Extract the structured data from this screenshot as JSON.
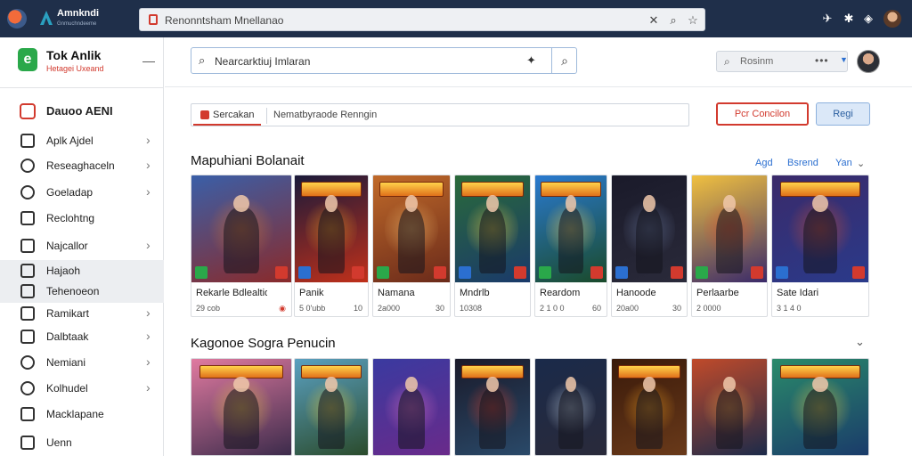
{
  "browser": {
    "app_title": "Amnkndi",
    "app_sub": "Gnmuchndeeme",
    "url": "Renonntsham Mnellanao",
    "icons": [
      "lock-icon",
      "close-icon",
      "search-icon",
      "star-icon",
      "pin-icon",
      "settings-icon",
      "location-icon"
    ]
  },
  "sidebar": {
    "brand_name": "Tok Anlik",
    "brand_sub": "Hetagei Uxeand",
    "menu_icon": "menu-icon",
    "head_label": "Dauoo AENI",
    "items": [
      {
        "label": "Aplk Ajdel",
        "icon": "square-icon",
        "chev": true
      },
      {
        "label": "Reseaghaceln",
        "icon": "smile-icon",
        "chev": true
      },
      {
        "label": "Goeladap",
        "icon": "circle-icon",
        "chev": true
      },
      {
        "label": "Reclohtng",
        "icon": "person-icon",
        "chev": false
      },
      {
        "label": "Najcallor",
        "icon": "square-icon",
        "chev": true
      },
      {
        "label": "Hajaoh",
        "icon": "square-icon",
        "chev": false
      },
      {
        "label": "Tehenoeon",
        "icon": "card-icon",
        "chev": false
      },
      {
        "label": "Ramikart",
        "icon": "search-icon",
        "chev": true
      },
      {
        "label": "Dalbtaak",
        "icon": "square-icon",
        "chev": true
      },
      {
        "label": "Nemiani",
        "icon": "search-circle-icon",
        "chev": true
      },
      {
        "label": "Kolhudel",
        "icon": "circle-icon",
        "chev": true
      },
      {
        "label": "Macklapane",
        "icon": "square-icon",
        "chev": false
      },
      {
        "label": "Uenn",
        "icon": "square-icon",
        "chev": false
      }
    ]
  },
  "search": {
    "value": "Nearcarktiuj Imlaran",
    "right_value": "Rosinm"
  },
  "filter": {
    "tab_label": "Sercakan",
    "text": "Nematbyraode Renngin"
  },
  "buttons": {
    "primary_outline": "Pcr Concilon",
    "secondary": "Regi"
  },
  "section1": {
    "title": "Mapuhiani Bolanait",
    "links": [
      "Agd",
      "Bsrend",
      "Yan"
    ]
  },
  "section2": {
    "title": "Kagonoe Sogra Penucin"
  },
  "games_row1": [
    {
      "title": "Rekarle Bdlealtiom",
      "meta": "29 cob",
      "value": "",
      "hot": true,
      "c1": "#3a5fa8",
      "c2": "#e27a2a",
      "c3": "#8a2a2a",
      "banner": false
    },
    {
      "title": "Panik",
      "meta": "5 0'ubb",
      "value": "10",
      "hot": false,
      "c1": "#1a1a3a",
      "c2": "#f0a020",
      "c3": "#c0301a",
      "banner": true
    },
    {
      "title": "Namana",
      "meta": "2a000",
      "value": "30",
      "hot": false,
      "c1": "#c06a2a",
      "c2": "#f2c070",
      "c3": "#6a2a1a",
      "banner": true
    },
    {
      "title": "Mndrlb",
      "meta": "10308",
      "value": "",
      "hot": false,
      "c1": "#2a6a3a",
      "c2": "#f0d040",
      "c3": "#1a3a6a",
      "banner": true
    },
    {
      "title": "Reardom",
      "meta": "2 1 0 0",
      "value": "60",
      "hot": false,
      "c1": "#2a7ad0",
      "c2": "#f0d060",
      "c3": "#1a4a2a",
      "banner": true
    },
    {
      "title": "Hanoode",
      "meta": "20a00",
      "value": "30",
      "hot": false,
      "c1": "#1a1a2a",
      "c2": "#6a7aa0",
      "c3": "#2a2a3a",
      "banner": false
    },
    {
      "title": "Perlaarbe",
      "meta": "2 0000",
      "value": "",
      "hot": false,
      "c1": "#f0c040",
      "c2": "#e04a2a",
      "c3": "#3a2a6a",
      "banner": false
    },
    {
      "title": "Sate Idari",
      "meta": "3 1 4 0",
      "value": "",
      "hot": false,
      "c1": "#3a2a6a",
      "c2": "#e0502a",
      "c3": "#2a3a8a",
      "banner": true
    }
  ],
  "games_row2": [
    {
      "c1": "#e07aa0",
      "c2": "#f0d040",
      "c3": "#3a2a4a",
      "banner": true
    },
    {
      "c1": "#5aa0c0",
      "c2": "#f0d040",
      "c3": "#2a4a2a",
      "banner": true
    },
    {
      "c1": "#3a3aa0",
      "c2": "#e070c0",
      "c3": "#6a2a8a",
      "banner": false
    },
    {
      "c1": "#1a1a2a",
      "c2": "#e0402a",
      "c3": "#2a4a6a",
      "banner": true
    },
    {
      "c1": "#1a2a4a",
      "c2": "#c0d0e0",
      "c3": "#2a2a3a",
      "banner": false
    },
    {
      "c1": "#3a1a0a",
      "c2": "#f0a020",
      "c3": "#6a3a1a",
      "banner": true
    },
    {
      "c1": "#c04a2a",
      "c2": "#f0a040",
      "c3": "#1a2a4a",
      "banner": false
    },
    {
      "c1": "#2a8a6a",
      "c2": "#f0d040",
      "c3": "#1a3a6a",
      "banner": true
    }
  ]
}
